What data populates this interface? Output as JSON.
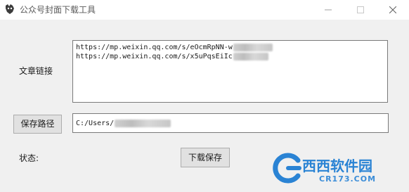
{
  "window": {
    "title": "公众号封面下载工具"
  },
  "form": {
    "url_label": "文章链接",
    "urls": [
      "https://mp.weixin.qq.com/s/eOcmRpNN-w",
      "https://mp.weixin.qq.com/s/x5uPqsEiIc"
    ],
    "save_path_button": "保存路径",
    "save_path_value": "C:/Users/",
    "status_label": "状态:",
    "download_button": "下载保存"
  },
  "watermark": {
    "text": "西西软件园",
    "sub": "CR173.COM"
  },
  "colors": {
    "background": "#f0f0f0",
    "titlebar": "#ffffff",
    "button": "#e1e1e1",
    "watermark": "#2a83d4"
  }
}
